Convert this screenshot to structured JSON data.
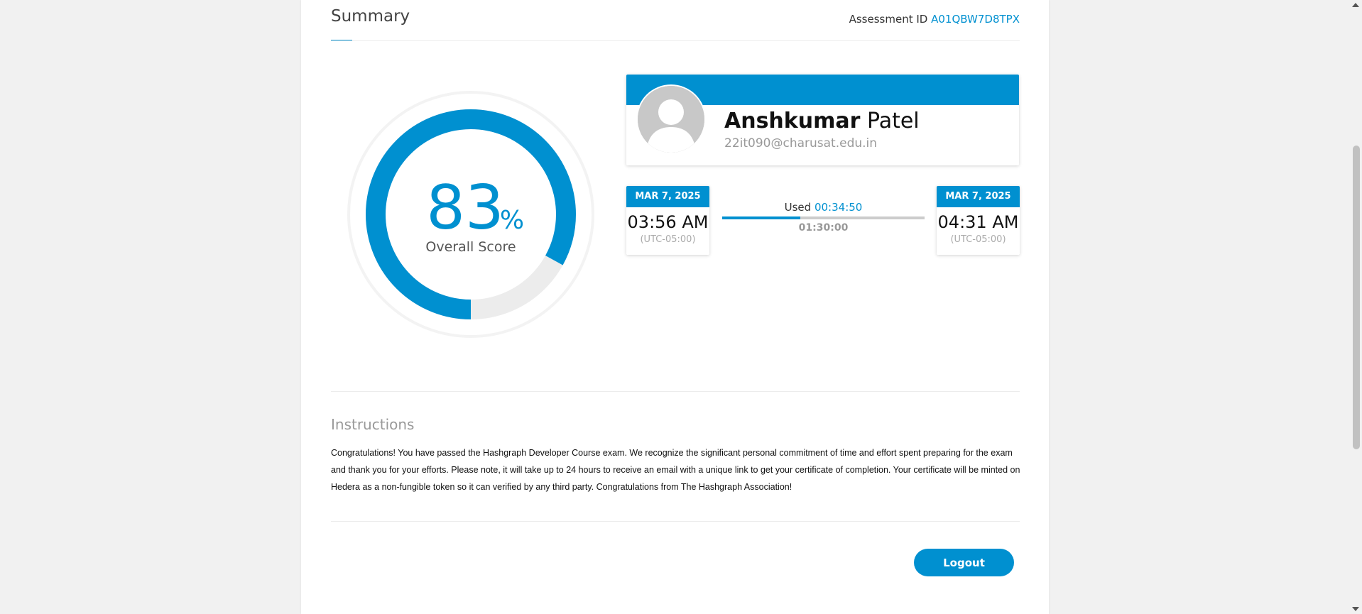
{
  "summary": {
    "title": "Summary",
    "assessment_label": "Assessment ID",
    "assessment_id": "A01QBW7D8TPX"
  },
  "score": {
    "value": "83",
    "percent_sign": "%",
    "label": "Overall Score",
    "fraction": 0.83
  },
  "profile": {
    "first_name": "Anshkumar",
    "last_name": "Patel",
    "email": "22it090@charusat.edu.in"
  },
  "start": {
    "date": "MAR 7, 2025",
    "time": "03:56 AM",
    "tz": "(UTC-05:00)"
  },
  "end": {
    "date": "MAR 7, 2025",
    "time": "04:31 AM",
    "tz": "(UTC-05:00)"
  },
  "duration": {
    "used_label": "Used",
    "used": "00:34:50",
    "total": "01:30:00",
    "fraction": 0.387
  },
  "instructions": {
    "title": "Instructions",
    "text": "Congratulations! You have passed the Hashgraph Developer Course exam. We recognize the significant personal commitment of time and effort spent preparing for the exam and thank you for your efforts. Please note, it will take up to 24 hours to receive an email with a unique link to get your certificate of completion. Your certificate will be minted on Hedera as a non-fungible token so it can verified by any third party. Congratulations from The Hashgraph Association!"
  },
  "actions": {
    "logout": "Logout"
  },
  "colors": {
    "accent": "#0090d0",
    "track": "#ececec"
  }
}
